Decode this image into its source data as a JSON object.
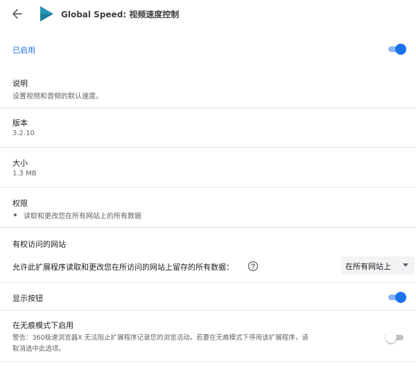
{
  "header": {
    "back_icon": "arrow-left-icon",
    "logo_icon": "play-triangle-logo",
    "title": "Global Speed: 视频速度控制",
    "accent": "#1a73e8",
    "logo_color": "#1b7f9b"
  },
  "enabled": {
    "label": "已启用",
    "on": true
  },
  "description": {
    "label": "说明",
    "value": "设置视频和音频的默认速度。"
  },
  "version": {
    "label": "版本",
    "value": "3.2.10"
  },
  "size": {
    "label": "大小",
    "value": "1.3 MB"
  },
  "permissions": {
    "label": "权限",
    "items": [
      "读取和更改您在所有网站上的所有数据"
    ]
  },
  "site_access": {
    "heading": "有权访问的网站",
    "prompt": "允许此扩展程序读取和更改您在所访问的网站上留存的所有数据：",
    "help_icon": "help-circle-icon",
    "selected": "在所有网站上"
  },
  "show_button": {
    "label": "显示按钮",
    "on": true
  },
  "incognito": {
    "label": "在无痕模式下启用",
    "warning_line1": "警告：360极速浏览器X 无法阻止扩展程序记录您的浏览活动。若要在无痕模式下停用该扩展程序，请",
    "warning_line2": "取消选中此选项。",
    "on": false
  }
}
